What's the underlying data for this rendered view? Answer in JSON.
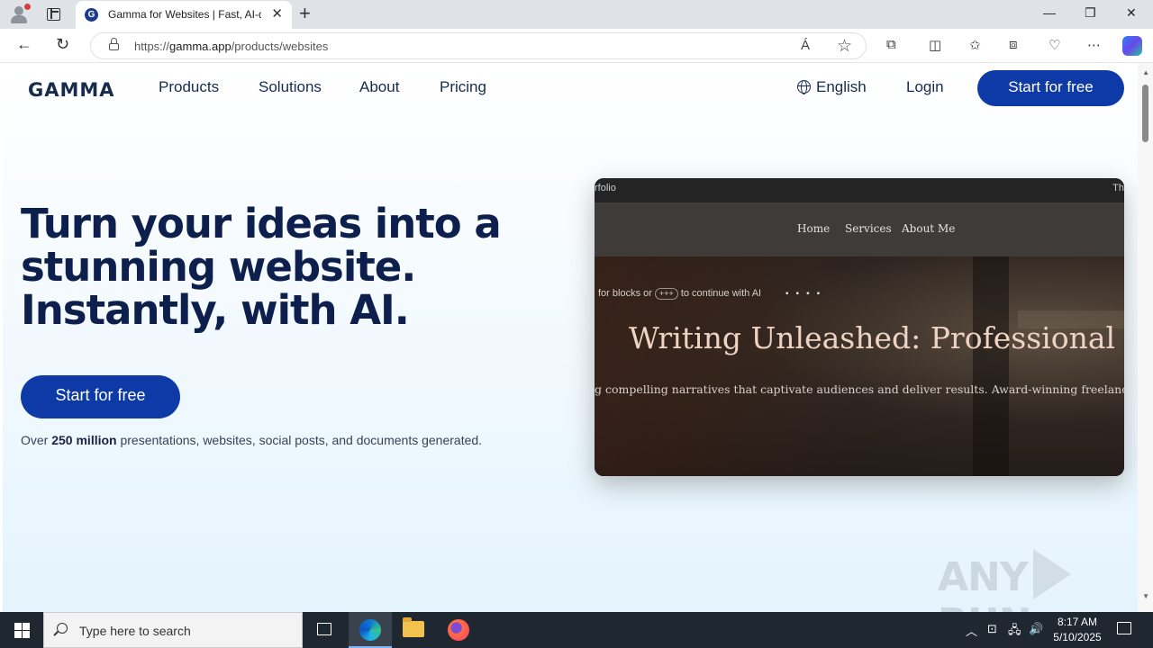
{
  "browser": {
    "tab_title": "Gamma for Websites | Fast, AI-dr",
    "tab_favicon_letter": "G",
    "new_tab_symbol": "+",
    "close_symbol": "✕",
    "minimize_symbol": "—",
    "restore_symbol": "❐",
    "window_close_symbol": "✕",
    "url_scheme": "https://",
    "url_host": "gamma.app",
    "url_path": "/products/websites",
    "read_aloud_symbol": "Á",
    "favorite_symbol": "☆",
    "back_symbol": "←",
    "refresh_symbol": "↻",
    "more_symbol": "⋯"
  },
  "site": {
    "logo": "GAMMA",
    "nav": {
      "products": "Products",
      "solutions": "Solutions",
      "about": "About",
      "pricing": "Pricing"
    },
    "language": "English",
    "login": "Login",
    "cta_header": "Start for free",
    "headline": "Turn your ideas into a stunning website. Instantly, with AI.",
    "cta_main": "Start for free",
    "stats_prefix": "Over ",
    "stats_bold": "250 million",
    "stats_suffix": " presentations, websites, social posts, and documents generated."
  },
  "preview": {
    "top_label": "rfolio",
    "top_right": "Th",
    "nav_items": [
      "Home",
      "Services",
      "About Me"
    ],
    "hint_prefix": "for blocks or",
    "hint_key": "+++",
    "hint_suffix": "to continue with AI",
    "title": "Writing Unleashed: Professional Po",
    "subtitle": "g compelling narratives that captivate audiences and deliver results. Award-winning freelance"
  },
  "watermark": {
    "left": "ANY",
    "right": "RUN"
  },
  "taskbar": {
    "search_placeholder": "Type here to search",
    "time": "8:17 AM",
    "date": "5/10/2025"
  },
  "colors": {
    "brand_navy": "#0d1f4c",
    "cta_blue": "#0e3aa7",
    "taskbar": "#1f2730"
  }
}
